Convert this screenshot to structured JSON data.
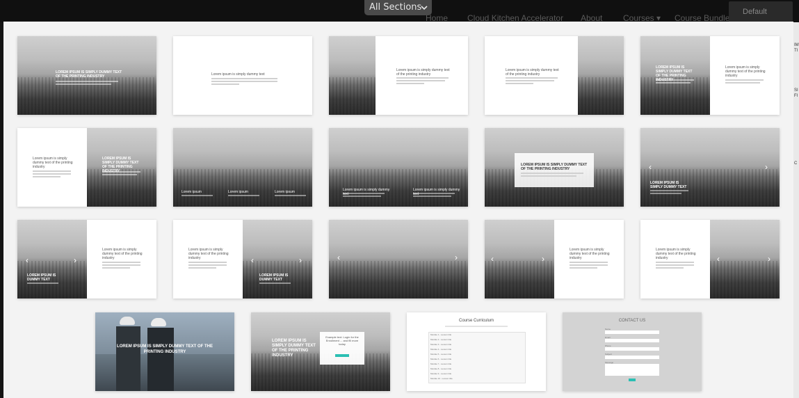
{
  "dropdown": {
    "label": "All Sections",
    "chevron_icon": "chevron-down-icon"
  },
  "background_nav": {
    "items": [
      "Home",
      "Cloud Kitchen Accelerator",
      "About",
      "Courses ▾",
      "Course Bundles"
    ],
    "default_button": "Default",
    "right_edge_text": [
      "IM",
      "TI",
      "SI",
      "FI",
      "C"
    ]
  },
  "sections": {
    "hero_title": "LOREM IPSUM IS SIMPLY DUMMY TEXT OF THE PRINTING INDUSTRY",
    "plain_title": "Lorem ipsum is simply dummy text",
    "split_title": "Lorem ipsum is simply dummy text of the printing industry",
    "split_title_short": "Lorem ipsum is simply dummy text of the printing industry",
    "slider_title": "LOREM IPSUM IS DUMMY TEXT",
    "slider_title_alt": "LOREM IPSUM IS SIMPLY DUMMY TEXT",
    "col_label": "Lorem ipsum",
    "col_title": "Lorem ipsum is simply dummy text",
    "box_title": "LOREM IPSUM IS SIMPLY DUMMY TEXT OF THE PRINTING INDUSTRY",
    "business_title": "LOREM IPSUM IS SIMPLY DUMMY TEXT OF THE PRINTING INDUSTRY",
    "cta_title": "LOREM IPSUM IS SIMPLY DUMMY TEXT OF THE PRINTING INDUSTRY",
    "cta_box_text": "Example text: Login for the Enrollment ... and fill more today",
    "curriculum_title": "Course Curriculum",
    "curriculum_rows": [
      "Module 1 - Lesson title",
      "Module 2 - Lesson title",
      "Module 3 - Lesson title",
      "Module 4 - Lesson title",
      "Module 5 - Lesson title",
      "Module 6 - Lesson title",
      "Module 7 - Lesson title",
      "Module 8 - Lesson title",
      "Module 9 - Lesson title",
      "Module 10 - Lesson title"
    ],
    "contact_title": "CONTACT US",
    "contact_fields": [
      "Name",
      "Email",
      "Phone",
      "Subject",
      "Message"
    ]
  },
  "colors": {
    "accent": "#2bbfb3",
    "panel": "#f3f3f3",
    "dropdown": "#4a4a4a"
  }
}
